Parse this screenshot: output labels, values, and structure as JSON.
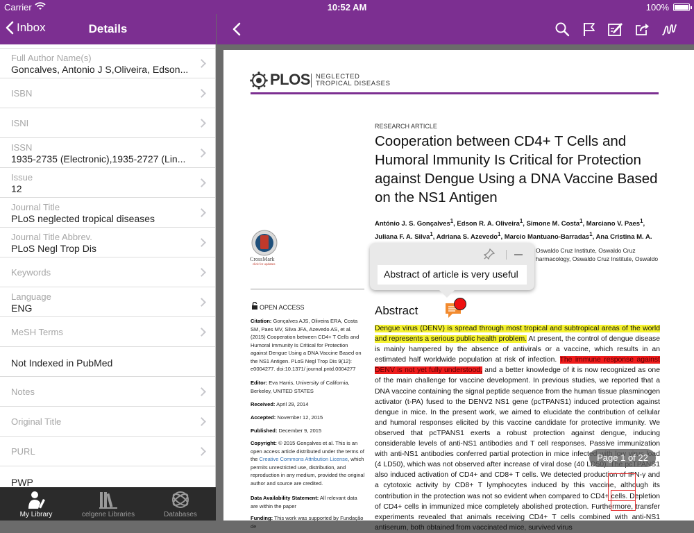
{
  "status_bar": {
    "carrier": "Carrier",
    "time": "10:52 AM",
    "battery": "100%"
  },
  "left_nav": {
    "back_label": "Inbox",
    "title": "Details"
  },
  "detail_rows": [
    {
      "label": "Full Author Name(s)",
      "value": "Goncalves, Antonio J S,Oliveira, Edson..."
    },
    {
      "label": "ISBN",
      "value": ""
    },
    {
      "label": "ISNI",
      "value": ""
    },
    {
      "label": "ISSN",
      "value": "1935-2735 (Electronic),1935-2727 (Lin..."
    },
    {
      "label": "Issue",
      "value": "12"
    },
    {
      "label": "Journal Title",
      "value": "PLoS neglected tropical diseases"
    },
    {
      "label": "Journal Title Abbrev.",
      "value": "PLoS Negl Trop Dis"
    },
    {
      "label": "Keywords",
      "value": ""
    },
    {
      "label": "Language",
      "value": "ENG"
    },
    {
      "label": "MeSH Terms",
      "value": ""
    },
    {
      "label": "",
      "value": "Not Indexed in PubMed"
    },
    {
      "label": "Notes",
      "value": ""
    },
    {
      "label": "Original Title",
      "value": ""
    },
    {
      "label": "PURL",
      "value": ""
    },
    {
      "label": "",
      "value": "PWP"
    }
  ],
  "tab_bar": [
    {
      "label": "My Library",
      "icon": "my-library-icon",
      "active": true
    },
    {
      "label": "celgene Libraries",
      "icon": "libraries-icon",
      "active": false
    },
    {
      "label": "Databases",
      "icon": "databases-icon",
      "active": false
    }
  ],
  "reader_toolbar": {
    "icons": [
      "back-chevron-icon",
      "search-icon",
      "flag-icon",
      "edit-note-icon",
      "share-icon",
      "signature-icon"
    ]
  },
  "document": {
    "journal_name": "PLOS",
    "journal_sub": [
      "NEGLECTED",
      "TROPICAL DISEASES"
    ],
    "article_type": "RESEARCH ARTICLE",
    "title": "Cooperation between CD4+ T Cells and Humoral Immunity Is Critical for Protection against Dengue Using a DNA Vaccine Based on the NS1 Antigen",
    "crossmark": "CrossMark",
    "crossmark_sub": "click for updates",
    "affiliation_line1": "Oswaldo Cruz Institute, Oswaldo Cruz",
    "affiliation_line2": "harmacology, Oswaldo Cruz Institute, Oswaldo",
    "open_access": "OPEN ACCESS",
    "citation_label": "Citation:",
    "citation_text": "Gonçalves AJS, Oliveira ERA, Costa SM, Paes MV, Silva JFA, Azevedo AS, et al. (2015) Cooperation between CD4+ T Cells and Humoral Immunity Is Critical for Protection against Dengue Using a DNA Vaccine Based on the NS1 Antigen. PLoS Negl Trop Dis 9(12): e0004277. doi:10.1371/ journal.pntd.0004277",
    "editor_label": "Editor:",
    "editor_text": "Eva Harris, University of California, Berkeley, UNITED STATES",
    "received_label": "Received:",
    "received_text": "April 29, 2014",
    "accepted_label": "Accepted:",
    "accepted_text": "November 12, 2015",
    "published_label": "Published:",
    "published_text": "December 9, 2015",
    "copyright_label": "Copyright:",
    "copyright_text_1": "© 2015 Gonçalves et al. This is an open access article distributed under the terms of the",
    "copyright_link": "Creative Commons Attribution License",
    "copyright_text_2": ", which permits unrestricted use, distribution, and reproduction in any medium, provided the original author and source are credited.",
    "data_label": "Data Availability Statement:",
    "data_text": "All relevant data are within the paper",
    "funding_label": "Funding:",
    "funding_text": "This work was supported by Fundação de",
    "abstract_heading": "Abstract",
    "abstract_hl_yellow": "Dengue virus (DENV) is spread through most tropical and subtropical areas of the world and represents a serious public health problem.",
    "abstract_part_1": " At present, the control of dengue disease is mainly hampered by the absence of antivirals or a vaccine, which results in an estimated half worldwide population at risk of infection. ",
    "abstract_hl_red": "The immune response against DENV is not yet fully understood,",
    "abstract_part_2": " and a better knowledge of it is now recognized as one of the main challenge for vaccine development. In previous studies, we reported that a DNA vaccine containing the signal peptide sequence from the human tissue plasminogen activator (t-PA) fused to the DENV2 NS1 gene (pcTPANS1) induced protection against dengue in mice. In the present work, we aimed to elucidate the contribution of cellular and humoral responses elicited by this vaccine candidate for protective immunity. We observed that pcTPANS1 exerts a robust protection against dengue, inducing considerable levels of anti-NS1 antibodies and T cell responses. Passive immunization with anti-NS1 antibodies conferred partial protection in mice infected with low virus load (4 LD50), which was not observed after increase of viral dose (40 LD50). The pcTPANS1 also induced activation of CD4+ and CD8+ T cells. We detected production of IFN-γ and a cytotoxic activity by CD8+ T lymphocytes induced by this vaccine, although its contribution in the protection was not so evident when compared to CD4+ cells. Depletion of CD4+ cells in immunized mice completely abolished protection. Furthermore, transfer experiments revealed that animals receiving CD4+ T cells combined with anti-NS1 antiserum, both obtained from vaccinated mice, survived virus"
  },
  "note_popup": {
    "text": "Abstract of article is very useful"
  },
  "page_indicator": "Page 1 of 22"
}
